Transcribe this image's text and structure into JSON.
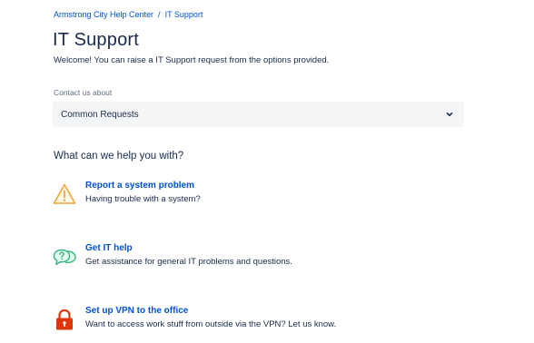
{
  "breadcrumb": {
    "home": "Armstrong City Help Center",
    "separator": "/",
    "current": "IT Support"
  },
  "page": {
    "title": "IT Support",
    "welcome": "Welcome! You can raise a IT Support request from the options provided."
  },
  "contact": {
    "label": "Contact us about",
    "selected": "Common Requests"
  },
  "help": {
    "heading": "What can we help you with?",
    "options": [
      {
        "title": "Report a system problem",
        "description": "Having trouble with a system?",
        "icon": "warning-triangle-icon",
        "icon_color": "#f2a43a"
      },
      {
        "title": "Get IT help",
        "description": "Get assistance for general IT problems and questions.",
        "icon": "chat-question-icon",
        "icon_color": "#36b37e"
      },
      {
        "title": "Set up VPN to the office",
        "description": "Want to access work stuff from outside via the VPN? Let us know.",
        "icon": "lock-icon",
        "icon_color": "#de350b"
      }
    ]
  },
  "colors": {
    "link": "#0052cc",
    "text": "#172b4d",
    "muted": "#5e6c84",
    "select_bg": "#f4f5f7"
  }
}
